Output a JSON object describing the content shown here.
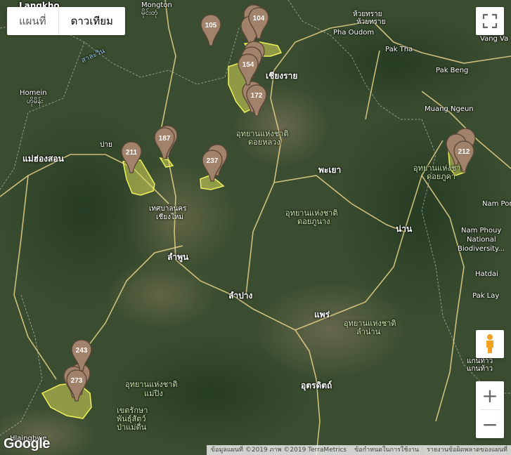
{
  "map_type": {
    "options": [
      "แผนที่",
      "ดาวเทียม"
    ],
    "selected": "ดาวเทียม"
  },
  "places": {
    "langkho": "Langkho",
    "mongton": "Mongton",
    "mongton_th": "မိုင်းတုံ",
    "salween": "สาละวิน",
    "homein": "Homein",
    "homein_mm": "ဟိုမိန်း",
    "mae_hong_son": "แม่ฮ่องสอน",
    "pai": "ปาย",
    "chiang_mai_1": "เทศบาลนคร",
    "chiang_mai_2": "เชียงใหม่",
    "lamphun": "ลำพูน",
    "lampang": "ลำปาง",
    "chiang_rai": "เชียงราย",
    "phayao": "พะเยา",
    "phrae": "แพร่",
    "nan": "น่าน",
    "uttaradit": "อุตรดิตถ์",
    "houayxay_1": "ห้วยทราย",
    "houayxay_2": "ห้วยทราย",
    "pha_oudom": "Pha Oudom",
    "pak_tha": "Pak Tha",
    "vang_va": "Vang Va",
    "pak_beng": "Pak Beng",
    "muang_ngeun": "Muang Ngeun",
    "nam_por": "Nam Por",
    "nam_phouy_1": "Nam Phouy",
    "nam_phouy_2": "National",
    "nam_phouy_3": "Biodiversity...",
    "hatdai": "Hatdai",
    "pak_lay": "Pak Lay",
    "kaenthao_1": "แกนท้าว",
    "kaenthao_2": "แกนท้าว",
    "hlaingbwe": "Hlaingbwe",
    "park_doi_luang_1": "อุทยานแห่งชาติ",
    "park_doi_luang_2": "ดอยหลวง",
    "park_doi_phu_nang_1": "อุทยานแห่งชาติ",
    "park_doi_phu_nang_2": "ดอยภูนาง",
    "park_nan_1": "อุทยานแห่งชาติ",
    "park_nan_2": "ดอยภูคา",
    "park_lam_nan_1": "อุทยานแห่งชาติ",
    "park_lam_nan_2": "ลำน่าน",
    "park_mae_ping_1": "อุทยานแห่งชาติ",
    "park_mae_ping_2": "แม่ปิง",
    "wildlife_1": "เขตรักษา",
    "wildlife_2": "พันธุ์สัตว์",
    "wildlife_3": "ป่าแม่ตื่น"
  },
  "markers": [
    {
      "id": "marker-105",
      "label": "105"
    },
    {
      "id": "marker-104",
      "label": "104"
    },
    {
      "id": "marker-154",
      "label": "154"
    },
    {
      "id": "marker-172",
      "label": "172"
    },
    {
      "id": "marker-187",
      "label": "187"
    },
    {
      "id": "marker-211",
      "label": "211"
    },
    {
      "id": "marker-237",
      "label": "237"
    },
    {
      "id": "marker-212",
      "label": "212"
    },
    {
      "id": "marker-243",
      "label": "243"
    },
    {
      "id": "marker-273",
      "label": "273"
    }
  ],
  "controls": {
    "fullscreen_icon": "fullscreen-icon",
    "pegman_icon": "pegman-icon",
    "zoom_in": "+",
    "zoom_out": "−"
  },
  "footer": {
    "attribution": "ข้อมูลแผนที่ ©2019 ภาพ ©2019 TerraMetrics",
    "terms": "ข้อกำหนดในการใช้งาน",
    "report": "รายงานข้อผิดพลาดของแผนที่"
  },
  "logo": "Google",
  "colors": {
    "marker": "#a1826a",
    "marker_stroke": "#5a4538",
    "area_fill": "#d6d85a",
    "area_stroke": "#eef25a",
    "road": "#e7d48a"
  }
}
